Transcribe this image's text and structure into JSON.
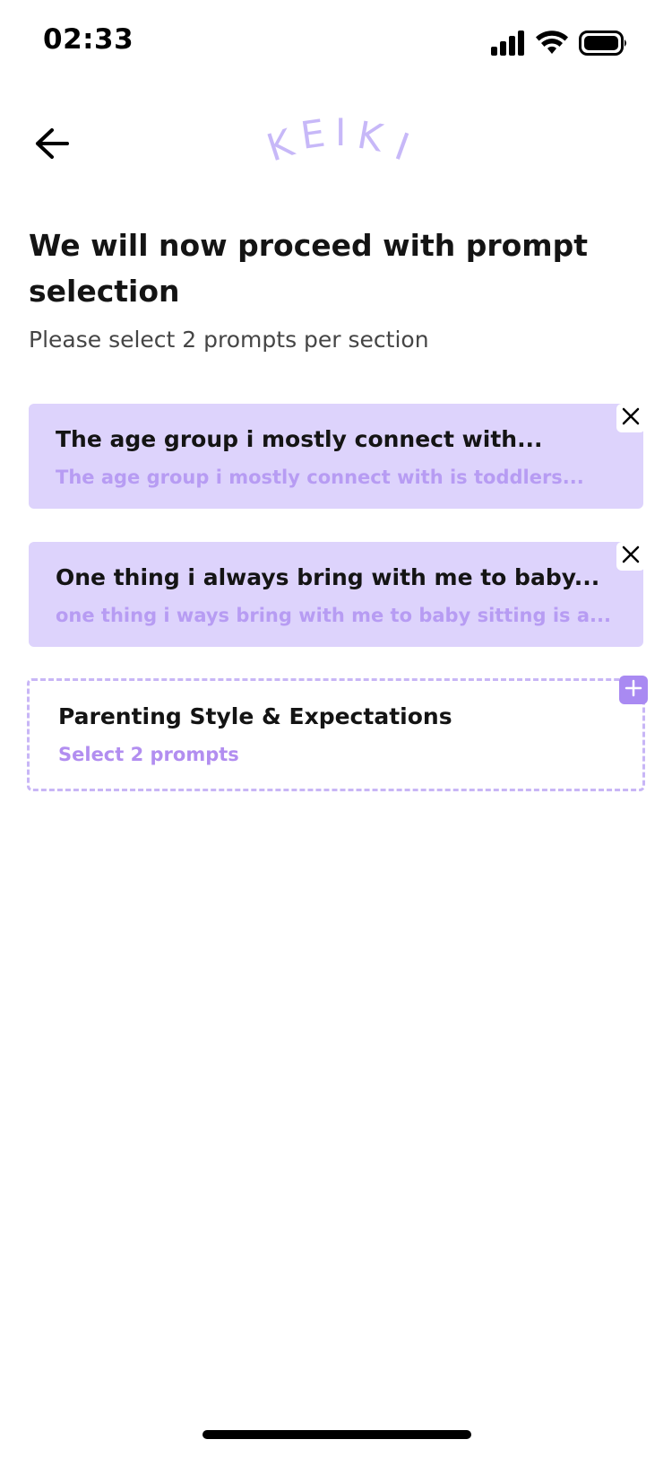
{
  "status_bar": {
    "time": "02:33",
    "icons": [
      "cellular-signal-icon",
      "wifi-icon",
      "battery-icon"
    ]
  },
  "header": {
    "back_icon": "arrow-left-icon",
    "logo_text": "KEIKI",
    "logo_color": "#c7b8f8"
  },
  "page": {
    "title": "We will now proceed with prompt selection",
    "subtitle": "Please select 2 prompts per section"
  },
  "selected_prompts": [
    {
      "title": "The age group i mostly connect with...",
      "answer": "The age group i mostly connect with is toddlers...",
      "remove_icon": "close-icon"
    },
    {
      "title": "One thing i always bring with me to baby...",
      "answer": "one thing i ways bring with me to baby sitting is a...",
      "remove_icon": "close-icon"
    }
  ],
  "pending_section": {
    "title": "Parenting Style & Expectations",
    "hint": "Select 2 prompts",
    "add_icon": "plus-icon"
  },
  "colors": {
    "card_background": "#ddd3fc",
    "answer_text": "#b79cf3",
    "accent": "#a98af2",
    "dashed_border": "#c8b6f6"
  }
}
